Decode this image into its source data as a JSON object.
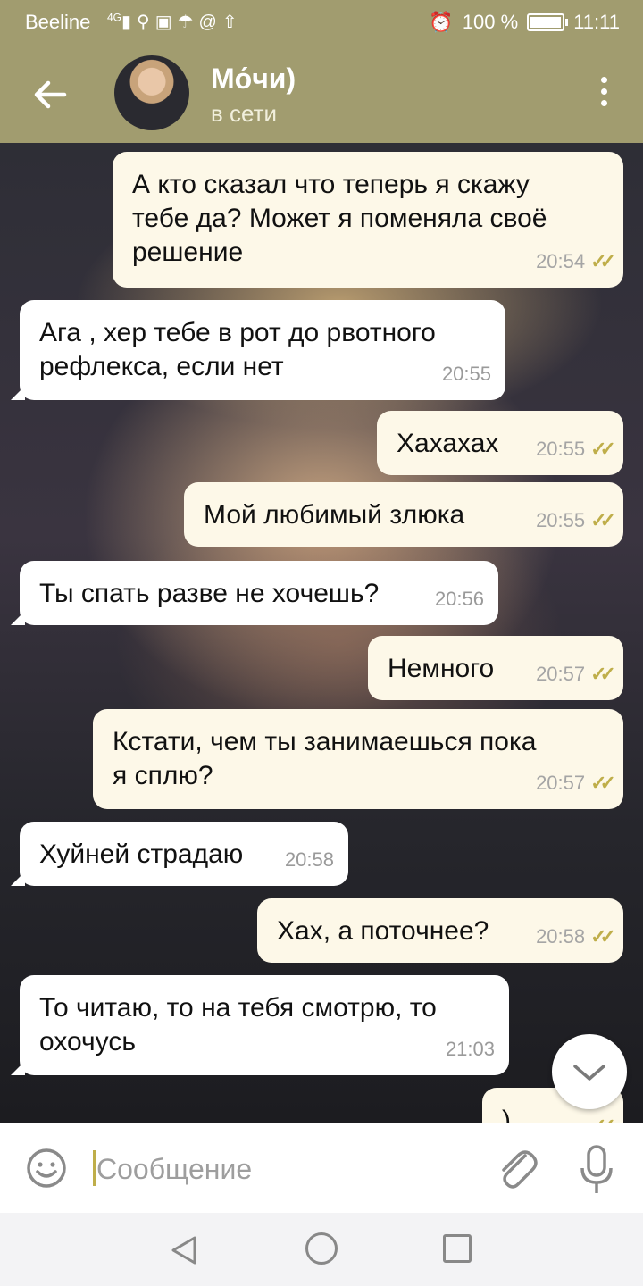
{
  "status_bar": {
    "carrier": "Beeline",
    "network": "4G",
    "battery_percent": "100 %",
    "battery_level": 1.0,
    "time": "11:11",
    "icons": [
      "signal-icon",
      "search-icon",
      "image-icon",
      "umbrella-icon",
      "at-icon",
      "upload-icon",
      "alarm-icon",
      "battery-icon"
    ]
  },
  "header": {
    "contact_name": "Мо́чи)",
    "contact_status": "в сети"
  },
  "messages": [
    {
      "direction": "out",
      "text": "А кто сказал что теперь я скажу\nтебе да? Может я поменяла своё\nрешение",
      "time": "20:54",
      "read": true
    },
    {
      "direction": "in",
      "text": "Ага , хер тебе в рот до рвотного\nрефлекса, если нет",
      "time": "20:55"
    },
    {
      "direction": "out",
      "text": "Хахахах",
      "time": "20:55",
      "read": true
    },
    {
      "direction": "out",
      "text": "Мой любимый злюка",
      "time": "20:55",
      "read": true
    },
    {
      "direction": "in",
      "text": "Ты спать разве не хочешь?",
      "time": "20:56"
    },
    {
      "direction": "out",
      "text": "Немного",
      "time": "20:57",
      "read": true
    },
    {
      "direction": "out",
      "text": "Кстати, чем ты занимаешься пока\nя сплю?",
      "time": "20:57",
      "read": true
    },
    {
      "direction": "in",
      "text": "Хуйней страдаю",
      "time": "20:58"
    },
    {
      "direction": "out",
      "text": "Хах, а поточнее?",
      "time": "20:58",
      "read": true
    },
    {
      "direction": "in",
      "text": "То читаю, то на тебя смотрю, то\nохочусь",
      "time": "21:03"
    },
    {
      "direction": "out",
      "text": ")",
      "time": "",
      "read": true
    }
  ],
  "composer": {
    "placeholder": "Сообщение"
  },
  "colors": {
    "header": "#a19c6f",
    "outgoing_bubble": "#fdf8e8",
    "incoming_bubble": "#ffffff",
    "check": "#bfae4a"
  }
}
